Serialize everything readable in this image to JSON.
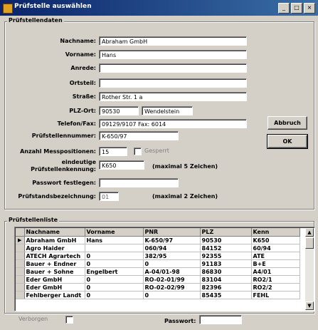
{
  "window": {
    "title": "Prüfstelle auswählen",
    "buttons": {
      "minimize": "_",
      "maximize": "□",
      "close": "×"
    }
  },
  "details": {
    "group_title": "Prüfstellendaten",
    "nachname_label": "Nachname:",
    "nachname_value": "Abraham GmbH",
    "vorname_label": "Vorname:",
    "vorname_value": "Hans",
    "anrede_label": "Anrede:",
    "anrede_value": "",
    "ortsteil_label": "Ortsteil:",
    "ortsteil_value": "",
    "strasse_label": "Straße:",
    "strasse_value": "Rother Str.  1 a",
    "plzort_label": "PLZ-Ort:",
    "plz_value": "90530",
    "ort_value": "Wendelstein",
    "telefon_label": "Telefon/Fax:",
    "telefon_value": "09129/9107    Fax: 6014",
    "pruefnr_label": "Prüfstellennummer:",
    "pruefnr_value": "K-650/97",
    "messpos_label": "Anzahl Messpositionen:",
    "messpos_value": "15",
    "gesperrt_label": "Gesperrt",
    "kennung_label_1": "eindeutige",
    "kennung_label_2": "Prüfstellenkennung:",
    "kennung_value": "K650",
    "kennung_note": "(maximal 5 Zeichen)",
    "passwort_label": "Passwort festlegen:",
    "passwort_value": "",
    "stand_label": "Prüfstandsbezeichnung:",
    "stand_value": "01",
    "stand_note": "(maximal 2 Zeichen)"
  },
  "actions": {
    "abbruch_label": "Abbruch",
    "ok_label": "OK"
  },
  "list": {
    "group_title": "Prüfstellenliste",
    "columns": [
      "Nachname",
      "Vorname",
      "PNR",
      "PLZ",
      "Kenn"
    ],
    "rows": [
      {
        "nachname": "Abraham GmbH",
        "vorname": "Hans",
        "pnr": "K-650/97",
        "plz": "90530",
        "kenn": "K650",
        "current": true
      },
      {
        "nachname": "Agro Haider",
        "vorname": "",
        "pnr": "060/94",
        "plz": "84152",
        "kenn": "60/94",
        "current": false
      },
      {
        "nachname": "ATECH Agrartech",
        "vorname": "0",
        "pnr": "382/95",
        "plz": "92355",
        "kenn": "ATE",
        "current": false
      },
      {
        "nachname": "Bauer + Endner",
        "vorname": "0",
        "pnr": "0",
        "plz": "91183",
        "kenn": "B+E",
        "current": false
      },
      {
        "nachname": "Bauer + Sohne",
        "vorname": "Engelbert",
        "pnr": "A-04/01-98",
        "plz": "86830",
        "kenn": "A4/01",
        "current": false
      },
      {
        "nachname": "Eder GmbH",
        "vorname": "0",
        "pnr": "RO-02-01/99",
        "plz": "83104",
        "kenn": "RO2/1",
        "current": false
      },
      {
        "nachname": "Eder GmbH",
        "vorname": "0",
        "pnr": "RO-02-02/99",
        "plz": "82396",
        "kenn": "RO2/2",
        "current": false
      },
      {
        "nachname": "Fehlberger Landt",
        "vorname": "0",
        "pnr": "0",
        "plz": "85435",
        "kenn": "FEHL",
        "current": false
      }
    ]
  },
  "footer": {
    "verborgen_label": "Verborgen",
    "passwort_label": "Passwort:",
    "passwort_value": ""
  }
}
